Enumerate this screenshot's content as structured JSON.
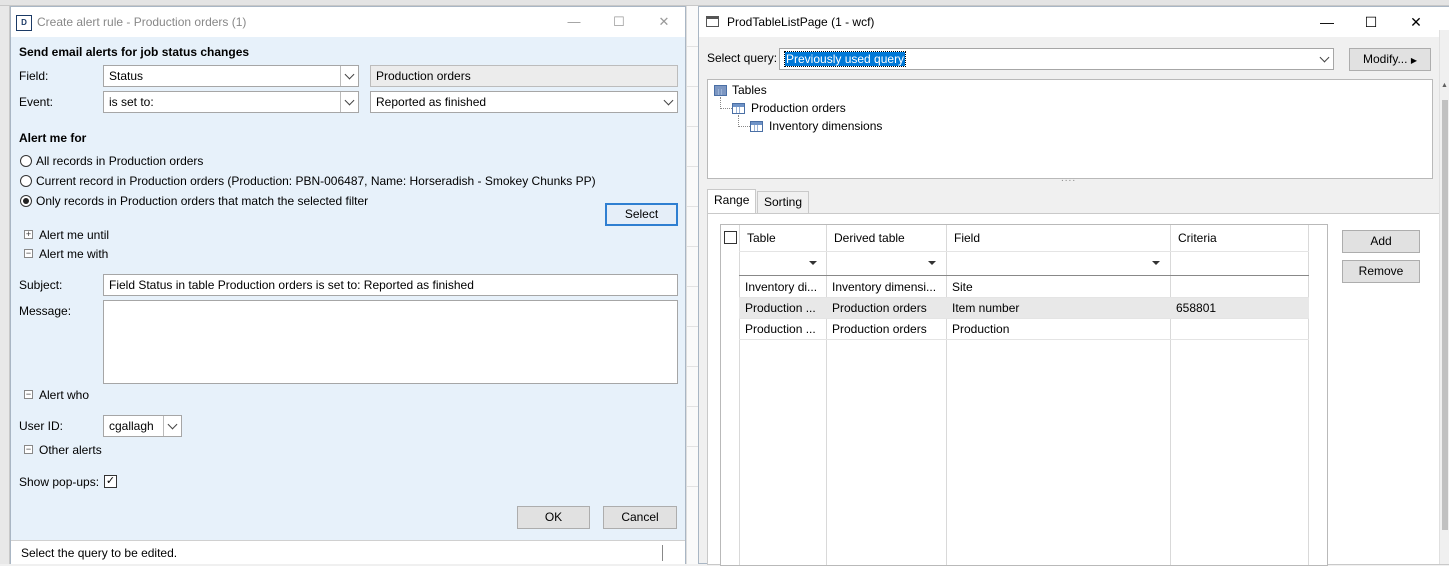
{
  "left_dialog": {
    "title": "Create alert rule - Production orders (1)",
    "section_heading": "Send email alerts for job status changes",
    "field_label": "Field:",
    "field_value": "Status",
    "field_table": "Production orders",
    "event_label": "Event:",
    "event_value": "is set to:",
    "event_target": "Reported as finished",
    "alert_me_for": "Alert me for",
    "radio_all": "All records in Production orders",
    "radio_current": "Current record in Production orders (Production: PBN-006487, Name: Horseradish - Smokey Chunks PP)",
    "radio_filter": "Only records in Production orders that match the selected filter",
    "select_button": "Select",
    "alert_until": "Alert me until",
    "alert_with": "Alert me with",
    "subject_label": "Subject:",
    "subject_value": "Field Status in table Production orders is set to: Reported as finished",
    "message_label": "Message:",
    "message_value": "",
    "alert_who": "Alert who",
    "userid_label": "User ID:",
    "userid_value": "cgallagh",
    "other_alerts": "Other alerts",
    "popups_label": "Show pop-ups:",
    "popups_checked": "✓",
    "ok_button": "OK",
    "cancel_button": "Cancel",
    "status_text": "Select the query to be edited."
  },
  "right_dialog": {
    "title": "ProdTableListPage (1 - wcf)",
    "select_query_label": "Select query:",
    "select_query_value": "Previously used query",
    "modify_button": "Modify...",
    "tree": {
      "root": "Tables",
      "child": "Production orders",
      "grandchild": "Inventory dimensions"
    },
    "tabs": [
      "Range",
      "Sorting"
    ],
    "grid": {
      "headers": [
        "Table",
        "Derived table",
        "Field",
        "Criteria"
      ],
      "rows": [
        [
          "Inventory di...",
          "Inventory dimensi...",
          "Site",
          ""
        ],
        [
          "Production ...",
          "Production orders",
          "Item number",
          "658801"
        ],
        [
          "Production ...",
          "Production orders",
          "Production",
          ""
        ]
      ]
    },
    "add_button": "Add",
    "remove_button": "Remove"
  }
}
